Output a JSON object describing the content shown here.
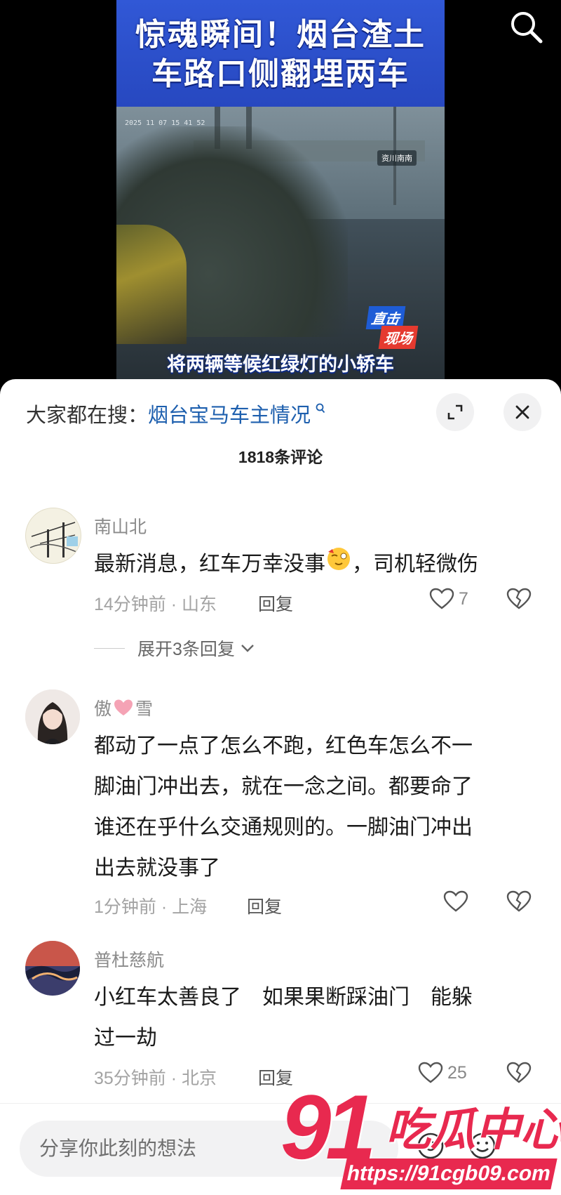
{
  "video": {
    "title_line1": "惊魂瞬间！烟台渣土",
    "title_line2": "车路口侧翻埋两车",
    "timestamp": "2025 11 07 15 41 52",
    "sign_text": "资川南南",
    "live_badge_top": "直击",
    "live_badge_bottom": "现场",
    "subtitle": "将两辆等候红绿灯的小轿车"
  },
  "hot_search": {
    "label": "大家都在搜：",
    "keyword": "烟台宝马车主情况"
  },
  "comment_count": "1818条评论",
  "comments": [
    {
      "name": "南山北",
      "text": "最新消息，红车万幸没事",
      "text_after_emoji": "，司机轻微伤",
      "time_location": "14分钟前 · 山东",
      "reply_label": "回复",
      "likes": "7",
      "expand_label": "展开3条回复"
    },
    {
      "name_part1": "傲",
      "name_part2": "雪",
      "text_lines": [
        "都动了一点了怎么不跑，红色车怎么不一",
        "脚油门冲出去，就在一念之间。都要命了",
        "谁还在乎什么交通规则的。一脚油门冲出",
        "出去就没事了"
      ],
      "time_location": "1分钟前 · 上海",
      "reply_label": "回复",
      "likes": ""
    },
    {
      "name": "普杜慈航",
      "text_lines": [
        "小红车太善良了　如果果断踩油门　能躲",
        "过一劫"
      ],
      "time_location": "35分钟前 · 北京",
      "reply_label": "回复",
      "likes": "25"
    }
  ],
  "input_placeholder": "分享你此刻的想法",
  "watermark": {
    "number": "91",
    "text": "吃瓜中心",
    "url": "https://91cgb09.com"
  },
  "colors": {
    "keyword_blue": "#1d5fae",
    "watermark_red": "#e8294f",
    "heart_pink": "#f5a3b5"
  }
}
